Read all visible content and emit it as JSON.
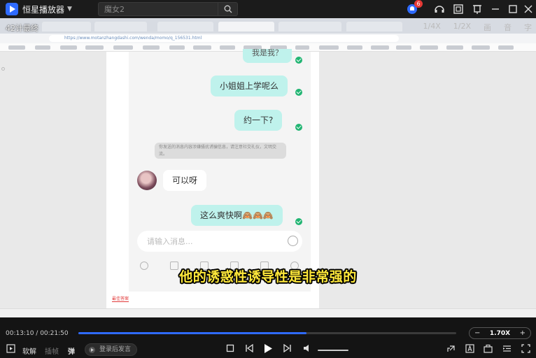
{
  "app": {
    "title": "恒星播放器",
    "notification_count": "6"
  },
  "search": {
    "placeholder": "魔女2"
  },
  "video": {
    "title": "42计最终",
    "tools": [
      "1/4X",
      "1/2X",
      "画",
      "音",
      "字"
    ],
    "subtitle": "他的诱惑性诱导性是非常强的",
    "browser_url": "https://www.motanzhangdashi.com/wenda/momo/q_156531.html"
  },
  "chat": {
    "msg_top_partial": "我是我？",
    "messages": [
      {
        "from": "me",
        "text": "小姐姐上学呢么"
      },
      {
        "from": "me",
        "text": "约一下?"
      },
      {
        "from": "them",
        "text": "可以呀"
      },
      {
        "from": "me",
        "text": "这么爽快啊🙈🙈🙈"
      }
    ],
    "system_note": "你发送的消息内容涉嫌骚扰诱骗信息，请注意社交礼仪，文明交流。",
    "input_placeholder": "请输入消息...",
    "best_answer": "最佳答案"
  },
  "player": {
    "current_time": "00:13:10",
    "total_time": "00:21:50",
    "progress": 0.603,
    "speed": "1.70X",
    "speed_minus": "−",
    "speed_plus": "+",
    "soft_decode": "软解",
    "frame_insert": "插帧",
    "danmu": "弹",
    "danmu_placeholder": "登录后发言",
    "volume": 1.0
  }
}
